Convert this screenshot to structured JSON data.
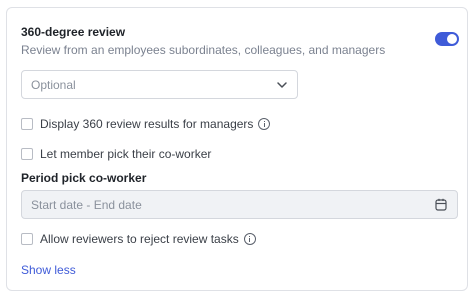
{
  "section": {
    "title": "360-degree review",
    "subtitle": "Review from an employees subordinates, colleagues, and managers",
    "toggle_on": true,
    "accent_color": "#3f5bd8"
  },
  "select": {
    "value": "Optional",
    "icon": "chevron-down-icon"
  },
  "options": {
    "display_results": {
      "label": "Display 360 review results for managers",
      "checked": false,
      "icon": "info-icon"
    },
    "member_pick": {
      "label": "Let member pick their co-worker",
      "checked": false
    },
    "allow_reject": {
      "label": "Allow reviewers to reject review tasks",
      "checked": false,
      "icon": "info-icon"
    }
  },
  "period": {
    "label": "Period pick co-worker",
    "placeholder": "Start date - End date",
    "icon": "calendar-icon"
  },
  "footer": {
    "show_less": "Show less"
  }
}
